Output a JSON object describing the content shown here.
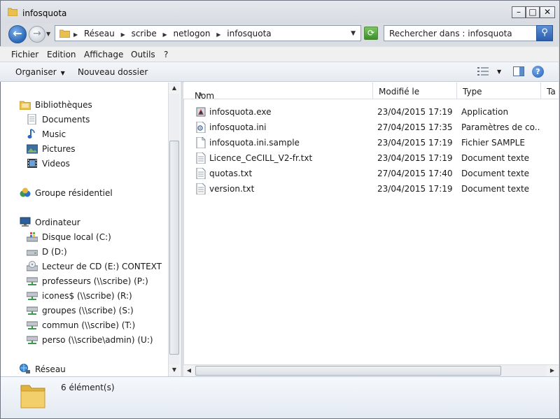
{
  "window": {
    "title": "infosquota"
  },
  "window_buttons": {
    "minimize": "–",
    "maximize": "□",
    "close": "✕"
  },
  "address": {
    "crumbs": [
      "Réseau",
      "scribe",
      "netlogon",
      "infosquota"
    ]
  },
  "search": {
    "placeholder": "Rechercher dans : infosquota"
  },
  "menu": {
    "items": [
      "Fichier",
      "Edition",
      "Affichage",
      "Outils",
      "?"
    ]
  },
  "toolbar": {
    "organize": "Organiser",
    "new_folder": "Nouveau dossier"
  },
  "nav": {
    "libraries": "Bibliothèques",
    "library_items": [
      "Documents",
      "Music",
      "Pictures",
      "Videos"
    ],
    "homegroup": "Groupe résidentiel",
    "computer": "Ordinateur",
    "drives": [
      "Disque local (C:)",
      "D (D:)",
      "Lecteur de CD (E:) CONTEXT",
      "professeurs (\\\\scribe) (P:)",
      "icones$ (\\\\scribe) (R:)",
      "groupes (\\\\scribe) (S:)",
      "commun (\\\\scribe) (T:)",
      "perso (\\\\scribe\\admin) (U:)"
    ],
    "network": "Réseau"
  },
  "columns": {
    "name": "Nom",
    "modified": "Modifié le",
    "type": "Type",
    "size": "Ta"
  },
  "files": [
    {
      "name": "infosquota.exe",
      "date": "23/04/2015 17:19",
      "type": "Application",
      "icon": "exe-icon"
    },
    {
      "name": "infosquota.ini",
      "date": "27/04/2015 17:35",
      "type": "Paramètres de co...",
      "icon": "ini-icon"
    },
    {
      "name": "infosquota.ini.sample",
      "date": "23/04/2015 17:19",
      "type": "Fichier SAMPLE",
      "icon": "file-icon"
    },
    {
      "name": "Licence_CeCILL_V2-fr.txt",
      "date": "23/04/2015 17:19",
      "type": "Document texte",
      "icon": "text-file-icon"
    },
    {
      "name": "quotas.txt",
      "date": "27/04/2015 17:40",
      "type": "Document texte",
      "icon": "text-file-icon"
    },
    {
      "name": "version.txt",
      "date": "23/04/2015 17:19",
      "type": "Document texte",
      "icon": "text-file-icon"
    }
  ],
  "status": {
    "count": "6 élément(s)"
  },
  "colors": {
    "accent": "#2a67b8",
    "folder": "#e9c04f"
  }
}
